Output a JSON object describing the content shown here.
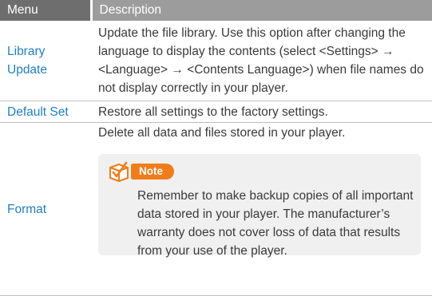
{
  "table": {
    "headers": {
      "menu": "Menu",
      "description": "Description"
    },
    "rows": [
      {
        "menu_lines": [
          "Library",
          "Update"
        ],
        "description": "Update the file library. Use this option after changing the language to display the contents (select <Settings> → <Language> → <Contents Language>) when file names do not display correctly in your player."
      },
      {
        "menu": "Default Set",
        "description": "Restore all settings to the factory settings."
      },
      {
        "menu": "Format",
        "description": "Delete all data and files stored in your player.",
        "note": {
          "label": "Note",
          "text": "Remember to make backup copies of all important data stored in your player. The manufacturer’s warranty does not cover loss of data that results from your use of the player."
        }
      }
    ]
  },
  "colors": {
    "menu_text": "#1f7fc6",
    "header_dark": "#6e6e6e",
    "header_light": "#9c9c9c",
    "note_accent": "#f07d1a",
    "note_background": "#f0f0f0"
  },
  "icons": {
    "note": "note-box-icon"
  }
}
